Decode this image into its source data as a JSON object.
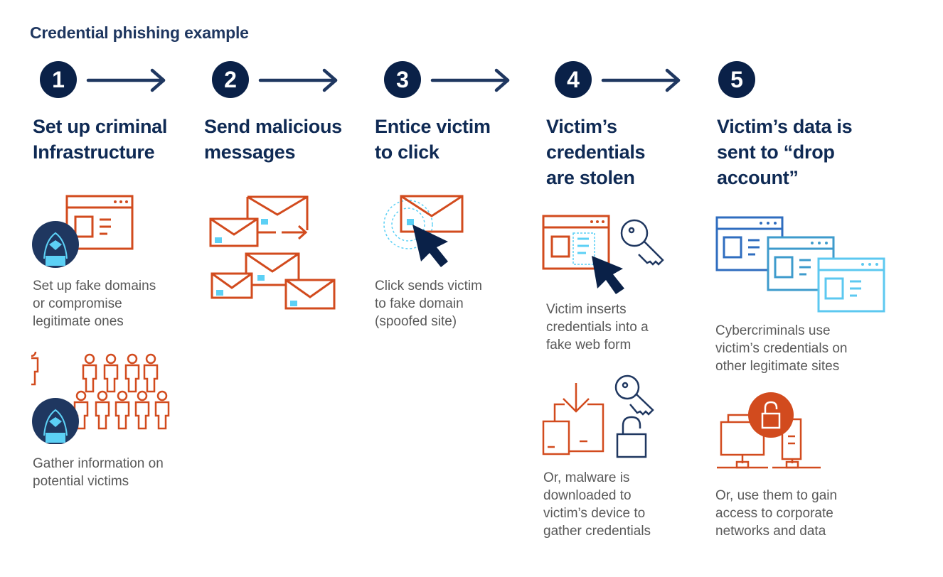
{
  "title": "Credential phishing example",
  "colors": {
    "navy": "#0a2148",
    "heading": "#0f2a54",
    "orange": "#d24b1e",
    "cyan": "#5cd0f5",
    "text_gray": "#595959"
  },
  "steps": [
    {
      "number": "1",
      "heading_lines": [
        "Set up criminal",
        "Infrastructure"
      ],
      "items": [
        {
          "icon": "hacker-fake-website-icon",
          "text_lines": [
            "Set up fake domains",
            "or compromise",
            "legitimate ones"
          ]
        },
        {
          "icon": "hacker-potential-victims-icon",
          "text_lines": [
            "Gather information on",
            "potential victims"
          ]
        }
      ]
    },
    {
      "number": "2",
      "heading_lines": [
        "Send malicious",
        "messages"
      ],
      "items": [
        {
          "icon": "malicious-emails-icon",
          "text_lines": []
        }
      ]
    },
    {
      "number": "3",
      "heading_lines": [
        "Entice victim",
        "to click"
      ],
      "items": [
        {
          "icon": "email-click-cursor-icon",
          "text_lines": [
            "Click sends victim",
            "to fake domain",
            "(spoofed site)"
          ]
        }
      ]
    },
    {
      "number": "4",
      "heading_lines": [
        "Victim’s",
        "credentials",
        "are stolen"
      ],
      "items": [
        {
          "icon": "fake-web-form-key-icon",
          "text_lines": [
            "Victim inserts",
            "credentials into a",
            "fake web form"
          ]
        },
        {
          "icon": "malware-download-key-lock-icon",
          "text_lines": [
            "Or, malware is",
            "downloaded to",
            "victim’s device to",
            "gather credentials"
          ]
        }
      ]
    },
    {
      "number": "5",
      "heading_lines": [
        "Victim’s data is",
        "sent to “drop",
        "account”"
      ],
      "items": [
        {
          "icon": "multiple-websites-icon",
          "text_lines": [
            "Cybercriminals use",
            "victim’s credentials on",
            "other legitimate sites"
          ]
        },
        {
          "icon": "corporate-network-unlocked-icon",
          "text_lines": [
            "Or, use them to gain",
            "access to corporate",
            "networks and data"
          ]
        }
      ]
    }
  ]
}
